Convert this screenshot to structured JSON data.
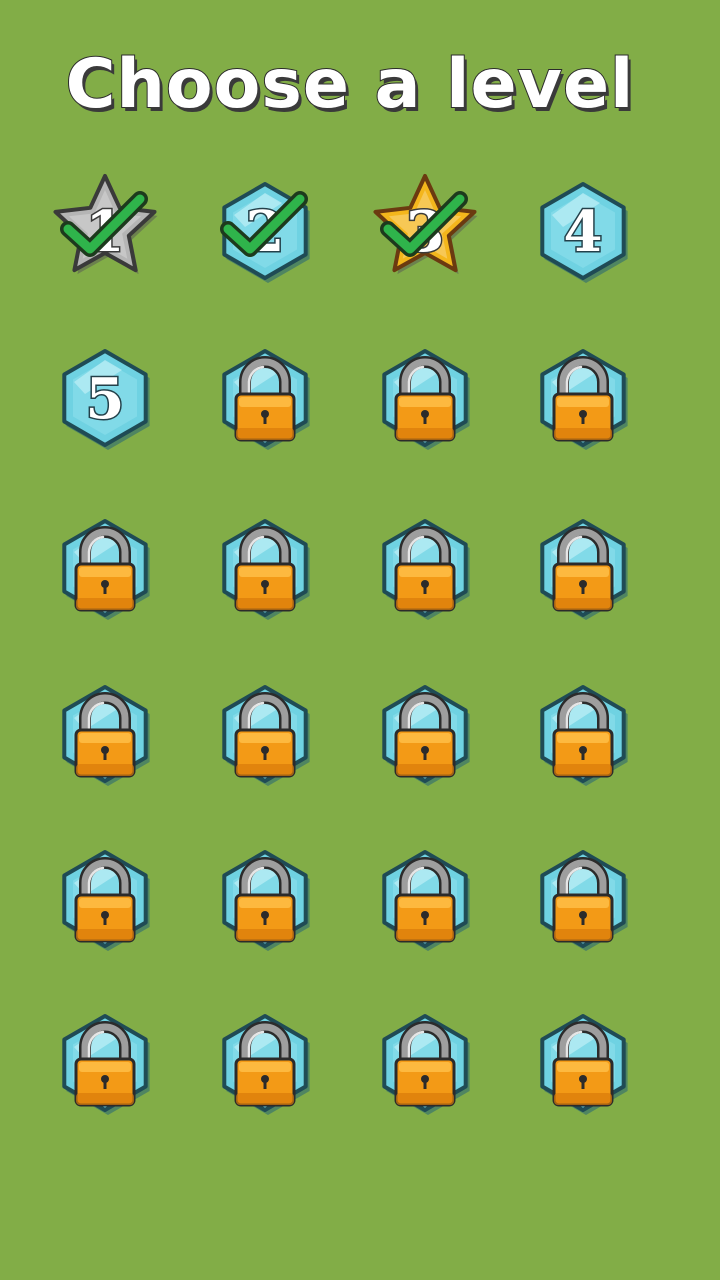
{
  "title": "Choose a level",
  "colors": {
    "background": "#82ad47",
    "hex_fill": "#6fd2e2",
    "hex_stroke": "#1f4b55",
    "lock_body": "#f39a16",
    "lock_shackle": "#9e9e9e",
    "check": "#2fb44b",
    "star_silver": "#b5b5b5",
    "star_gold": "#f4b61c"
  },
  "levels": [
    {
      "number": "1",
      "state": "completed",
      "badge": "silver-star-icon",
      "checked": true
    },
    {
      "number": "2",
      "state": "completed",
      "badge": "hexagon-icon",
      "checked": true
    },
    {
      "number": "3",
      "state": "completed",
      "badge": "gold-star-icon",
      "checked": true
    },
    {
      "number": "4",
      "state": "unlocked",
      "badge": "hexagon-icon",
      "checked": false
    },
    {
      "number": "5",
      "state": "unlocked",
      "badge": "hexagon-icon",
      "checked": false
    },
    {
      "number": "",
      "state": "locked",
      "badge": "lock-icon",
      "checked": false
    },
    {
      "number": "",
      "state": "locked",
      "badge": "lock-icon",
      "checked": false
    },
    {
      "number": "",
      "state": "locked",
      "badge": "lock-icon",
      "checked": false
    },
    {
      "number": "",
      "state": "locked",
      "badge": "lock-icon",
      "checked": false
    },
    {
      "number": "",
      "state": "locked",
      "badge": "lock-icon",
      "checked": false
    },
    {
      "number": "",
      "state": "locked",
      "badge": "lock-icon",
      "checked": false
    },
    {
      "number": "",
      "state": "locked",
      "badge": "lock-icon",
      "checked": false
    },
    {
      "number": "",
      "state": "locked",
      "badge": "lock-icon",
      "checked": false
    },
    {
      "number": "",
      "state": "locked",
      "badge": "lock-icon",
      "checked": false
    },
    {
      "number": "",
      "state": "locked",
      "badge": "lock-icon",
      "checked": false
    },
    {
      "number": "",
      "state": "locked",
      "badge": "lock-icon",
      "checked": false
    },
    {
      "number": "",
      "state": "locked",
      "badge": "lock-icon",
      "checked": false
    },
    {
      "number": "",
      "state": "locked",
      "badge": "lock-icon",
      "checked": false
    },
    {
      "number": "",
      "state": "locked",
      "badge": "lock-icon",
      "checked": false
    },
    {
      "number": "",
      "state": "locked",
      "badge": "lock-icon",
      "checked": false
    },
    {
      "number": "",
      "state": "locked",
      "badge": "lock-icon",
      "checked": false
    },
    {
      "number": "",
      "state": "locked",
      "badge": "lock-icon",
      "checked": false
    },
    {
      "number": "",
      "state": "locked",
      "badge": "lock-icon",
      "checked": false
    },
    {
      "number": "",
      "state": "locked",
      "badge": "lock-icon",
      "checked": false
    }
  ]
}
